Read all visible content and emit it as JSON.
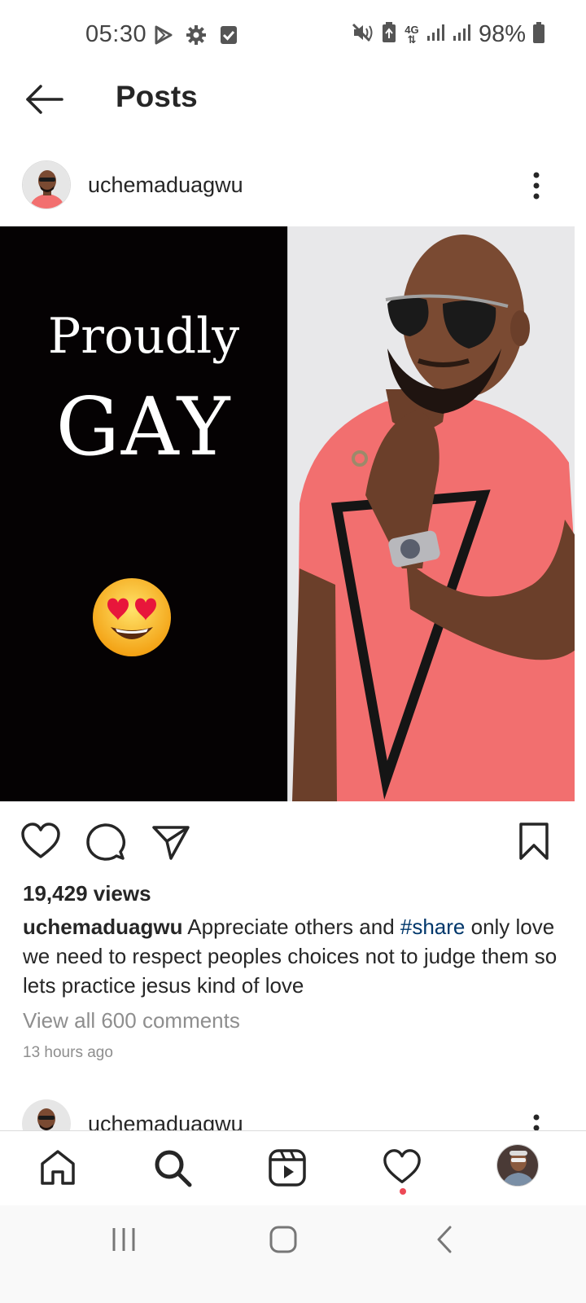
{
  "status_bar": {
    "time": "05:30",
    "battery_percent": "98%",
    "network_label": "4G",
    "icons": [
      "play-store-icon",
      "settings-icon",
      "checkbox-icon",
      "mute-icon",
      "battery-saver-icon",
      "signal-icon",
      "battery-icon"
    ]
  },
  "header": {
    "title": "Posts",
    "back_icon": "arrow-left-icon"
  },
  "post": {
    "username": "uchemaduagwu",
    "media": {
      "overlay_line1": "Proudly",
      "overlay_line2": "GAY",
      "emoji": "heart-eyes-emoji"
    },
    "views": "19,429 views",
    "caption_user": "uchemaduagwu",
    "caption_before": " Appreciate others and ",
    "caption_hashtag": "#share",
    "caption_after": " only love we need to respect peoples choices not to judge them so lets practice jesus kind of love",
    "view_comments": "View all 600 comments",
    "time_ago": "13 hours ago"
  },
  "next_post": {
    "username": "uchemaduagwu"
  },
  "bottom_nav": {
    "items": [
      "home-icon",
      "search-icon",
      "reels-icon",
      "activity-icon",
      "profile-avatar"
    ],
    "activity_has_notification": true
  },
  "colors": {
    "hashtag": "#00376b",
    "muted_text": "#8e8e8e",
    "notification_dot": "#ed4956",
    "shirt": "#f26f6f"
  }
}
